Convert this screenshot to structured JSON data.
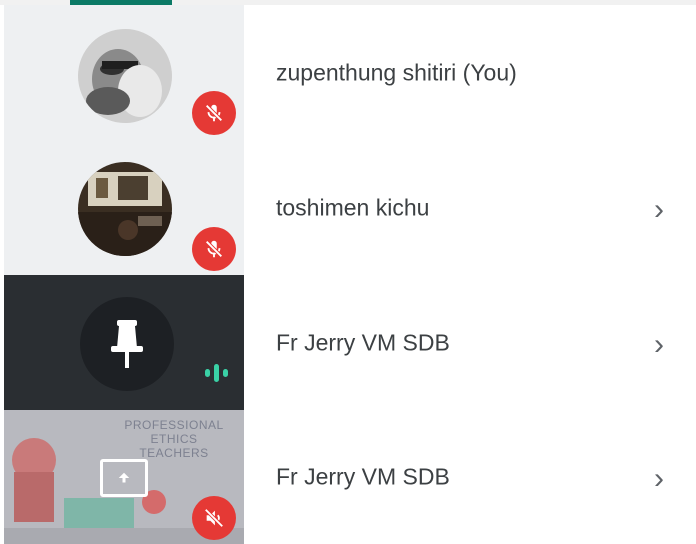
{
  "participants": [
    {
      "name": "zupenthung shitiri (You)",
      "muted": true,
      "has_chevron": false,
      "avatar": "photo"
    },
    {
      "name": "toshimen kichu",
      "muted": true,
      "has_chevron": true,
      "avatar": "photo"
    },
    {
      "name": "Fr Jerry VM SDB",
      "muted": false,
      "speaking": true,
      "has_chevron": true,
      "avatar": "pin-icon"
    },
    {
      "name": "Fr Jerry VM SDB",
      "muted": true,
      "has_chevron": true,
      "avatar": "screen-share"
    }
  ],
  "screen_share_preview": {
    "line1": "PROFESSIONAL",
    "line2": "ETHICS",
    "line3": "TEACHERS"
  },
  "chevron_glyph": "›",
  "colors": {
    "accent": "#0b7a66",
    "mute_badge": "#e53935",
    "speaking": "#3ad1a6"
  }
}
